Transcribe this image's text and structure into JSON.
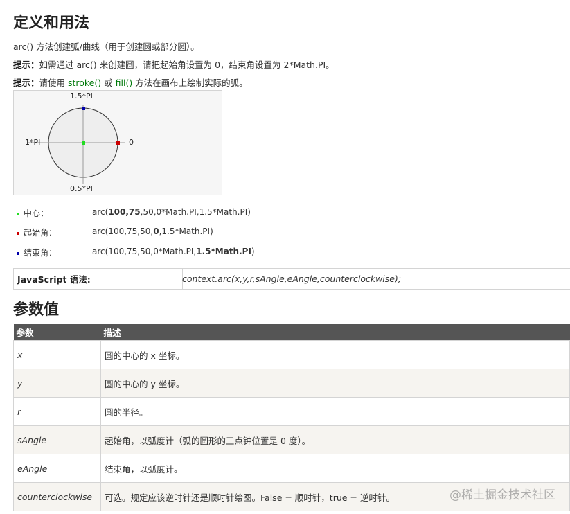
{
  "section_title": "定义和用法",
  "intro": "arc() 方法创建弧/曲线（用于创建圆或部分圆）。",
  "tip1": {
    "label": "提示：",
    "text": "如需通过 arc() 来创建圆，请把起始角设置为 0，结束角设置为 2*Math.PI。"
  },
  "tip2": {
    "label": "提示：",
    "pre": "请使用 ",
    "link1": "stroke()",
    "mid": " 或 ",
    "link2": "fill()",
    "post": " 方法在画布上绘制实际的弧。"
  },
  "diagram": {
    "label_top": "1.5*PI",
    "label_left": "1*PI",
    "label_right": "0",
    "label_bottom": "0.5*PI",
    "colors": {
      "center": "#22dd22",
      "start": "#cc0000",
      "end": "#0000aa"
    }
  },
  "legend": [
    {
      "label": "中心：",
      "pre": "arc(",
      "bold": "100,75",
      "post": ",50,0*Math.PI,1.5*Math.PI)"
    },
    {
      "label": "起始角：",
      "pre": "arc(100,75,50,",
      "bold": "0",
      "post": ",1.5*Math.PI)"
    },
    {
      "label": "结束角：",
      "pre": "arc(100,75,50,0*Math.PI,",
      "bold": "1.5*Math.PI",
      "post": ")"
    }
  ],
  "syntax": {
    "label": "JavaScript 语法:",
    "code": "context.arc(x,y,r,sAngle,eAngle,counterclockwise);"
  },
  "params_title": "参数值",
  "params_table": {
    "headers": [
      "参数",
      "描述"
    ],
    "rows": [
      {
        "name": "x",
        "desc": "圆的中心的 x 坐标。"
      },
      {
        "name": "y",
        "desc": "圆的中心的 y 坐标。"
      },
      {
        "name": "r",
        "desc": "圆的半径。"
      },
      {
        "name": "sAngle",
        "desc": "起始角，以弧度计（弧的圆形的三点钟位置是 0 度）。"
      },
      {
        "name": "eAngle",
        "desc": "结束角，以弧度计。"
      },
      {
        "name": "counterclockwise",
        "desc": "可选。规定应该逆时针还是顺时针绘图。False = 顺时针，true = 逆时针。"
      }
    ]
  },
  "watermark": "@稀土掘金技术社区"
}
